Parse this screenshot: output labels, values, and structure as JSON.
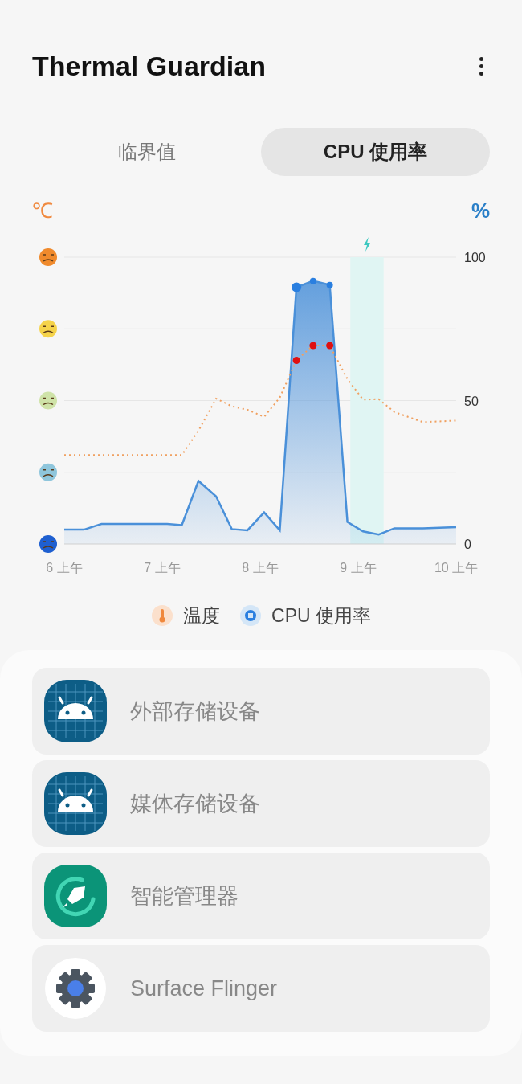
{
  "header": {
    "title": "Thermal Guardian"
  },
  "tabs": [
    {
      "label": "临界值",
      "selected": false
    },
    {
      "label": "CPU 使用率",
      "selected": true
    }
  ],
  "chart": {
    "left_unit": "℃",
    "right_unit": "%",
    "chart_data": {
      "type": "area",
      "x": [
        6,
        6.2,
        6.38,
        7.05,
        7.2,
        7.37,
        7.55,
        7.71,
        7.87,
        8.04,
        8.2,
        8.37,
        8.54,
        8.71,
        8.89,
        9.05,
        9.21,
        9.37,
        9.66,
        10
      ],
      "series": [
        {
          "name": "温度",
          "type": "line",
          "line_style": "dotted",
          "color": "#f0a060",
          "values": [
            31,
            31,
            31,
            31,
            31,
            39.5,
            50.7,
            48,
            46.8,
            44.3,
            51,
            64,
            69.2,
            69.2,
            57.5,
            50.3,
            50.5,
            46,
            42.5,
            43
          ]
        },
        {
          "name": "CPU 使用率",
          "type": "area",
          "color": "#4a90d9",
          "values": [
            5,
            5,
            7,
            7,
            6.6,
            22,
            16.6,
            5.2,
            4.8,
            11,
            4.8,
            89.5,
            91.7,
            90.3,
            7.7,
            4.4,
            3.3,
            5.5,
            5.5,
            5.9
          ]
        }
      ],
      "xlim": [
        6,
        10
      ],
      "ylim": [
        0,
        100
      ],
      "xticks": [
        {
          "value": 6,
          "label": "6 上午"
        },
        {
          "value": 7,
          "label": "7 上午"
        },
        {
          "value": 8,
          "label": "8 上午"
        },
        {
          "value": 9,
          "label": "9 上午"
        },
        {
          "value": 10,
          "label": "10 上午"
        }
      ],
      "yticks": [
        0,
        50,
        100
      ],
      "bands": [
        {
          "axis": "x",
          "from": 8.92,
          "to": 9.26
        }
      ]
    }
  },
  "legend": [
    {
      "kind": "temperature"
    },
    {
      "kind": "cpu"
    }
  ],
  "apps": [
    {
      "name": "外部存储设备",
      "kind": "android"
    },
    {
      "name": "媒体存储设备",
      "kind": "android"
    },
    {
      "name": "智能管理器",
      "kind": "rocket"
    },
    {
      "name": "Surface Flinger",
      "kind": "gear"
    }
  ]
}
